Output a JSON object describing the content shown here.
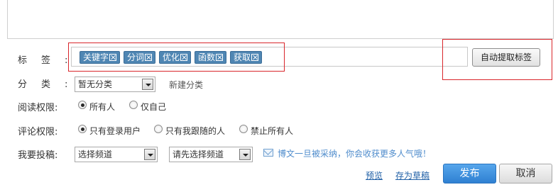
{
  "form": {
    "tags_label": "标签:",
    "tags": [
      "关键字",
      "分词",
      "优化",
      "函数",
      "获取"
    ],
    "auto_extract_button": "自动提取标签",
    "category_label": "分类:",
    "category_select": "暂无分类",
    "new_category_link": "新建分类",
    "read_permission_label": "阅读权限:",
    "read_options": [
      "所有人",
      "仅自己"
    ],
    "read_selected": "所有人",
    "comment_permission_label": "评论权限:",
    "comment_options": [
      "只有登录用户",
      "只有我跟随的人",
      "禁止所有人"
    ],
    "comment_selected": "只有登录用户",
    "submit_label": "我要投稿:",
    "channel_select": "选择频道",
    "subchannel_select": "请先选择频道",
    "hint_text": "博文一旦被采纳，你会收获更多人气哦！",
    "preview_link": "预览",
    "save_draft_link": "存为草稿",
    "publish_button": "发布",
    "cancel_button": "取消"
  }
}
